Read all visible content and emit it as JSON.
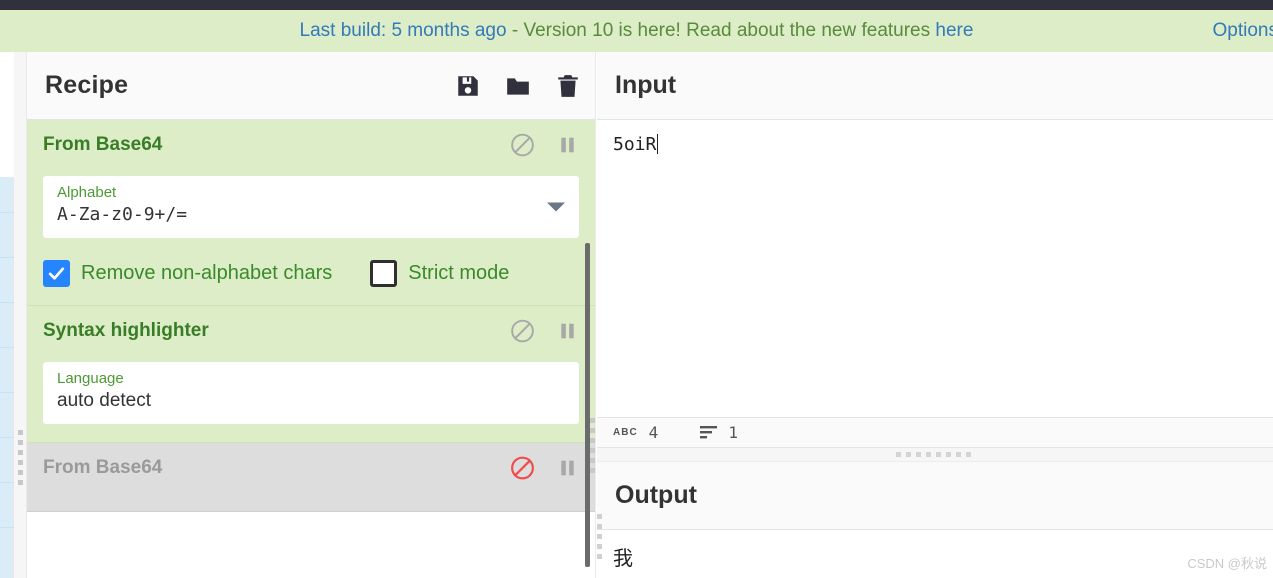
{
  "banner": {
    "build_text": "Last build: 5 months ago",
    "separator": " - ",
    "version_text": "Version 10 is here! Read about the new features ",
    "here_link": "here",
    "options_link": "Options"
  },
  "recipe": {
    "title": "Recipe",
    "icons": {
      "save": "save-icon",
      "load": "folder-icon",
      "clear": "trash-icon"
    },
    "operations": [
      {
        "name": "From Base64",
        "disabled": false,
        "disable_icon_color": "#a8a8a8",
        "fields": [
          {
            "label": "Alphabet",
            "value": "A-Za-z0-9+/=",
            "type": "select"
          }
        ],
        "checkboxes": [
          {
            "label": "Remove non-alphabet chars",
            "checked": true
          },
          {
            "label": "Strict mode",
            "checked": false
          }
        ]
      },
      {
        "name": "Syntax highlighter",
        "disabled": false,
        "disable_icon_color": "#a8a8a8",
        "fields": [
          {
            "label": "Language",
            "value": "auto detect",
            "type": "text"
          }
        ],
        "checkboxes": []
      },
      {
        "name": "From Base64",
        "disabled": true,
        "disable_icon_color": "#f04a4a",
        "fields": [],
        "checkboxes": []
      }
    ]
  },
  "input": {
    "title": "Input",
    "value": "5oiR",
    "status": {
      "chars_icon": "ABC",
      "chars": "4",
      "lines_icon": "lines-icon",
      "lines": "1"
    }
  },
  "output": {
    "title": "Output",
    "value": "我"
  },
  "watermark": "CSDN @秋说",
  "colors": {
    "banner_bg": "#dcedc8",
    "link_blue": "#337ab7",
    "banner_green": "#5a8a3c",
    "op_bg": "#dcedc8",
    "op_title_green": "#3a7d27",
    "checkbox_blue": "#2684ff",
    "disabled_bg": "#dddddd",
    "disabled_text": "#9a9a9a",
    "disabled_icon_red": "#f04a4a"
  }
}
